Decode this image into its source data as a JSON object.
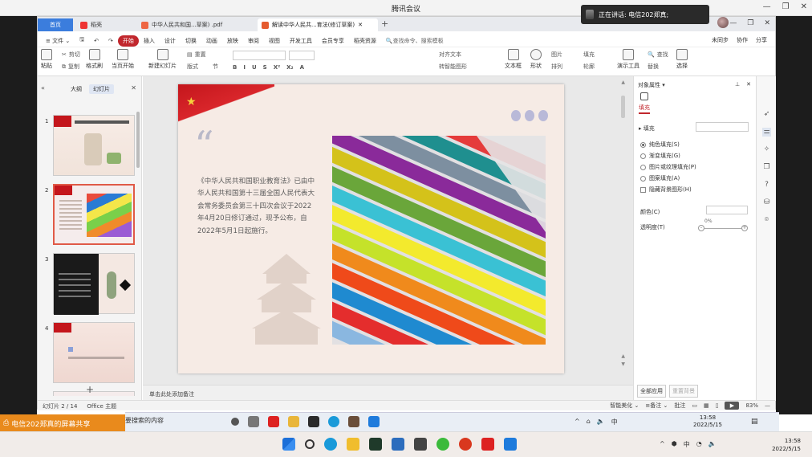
{
  "meeting": {
    "title": "腾讯会议",
    "speaking": "正在讲话: 电信202郑真;",
    "share_label": "电信202郑真的屏幕共享"
  },
  "tabs": {
    "home": "首页",
    "t2": "稻壳",
    "t3": "中华人民共和国...草案) .pdf",
    "t4": "解读中华人民共...育法(修订草案)",
    "plus": "+"
  },
  "menu": {
    "file": "≡ 文件 ⌄",
    "items": [
      "开始",
      "插入",
      "设计",
      "切换",
      "动画",
      "放映",
      "审阅",
      "视图",
      "开发工具",
      "会员专享",
      "稻壳资源"
    ],
    "search": "🔍查找命令、搜索模板",
    "right": [
      "未同步",
      "协作",
      "分享"
    ]
  },
  "ribbon": {
    "cut": "剪切",
    "copy": "复制",
    "painter": "格式刷",
    "paste": "粘贴",
    "from_start": "当页开始",
    "new_slide": "新建幻灯片",
    "layout": "版式",
    "section": "节",
    "reset": "重置",
    "textbox": "文本框",
    "shape": "形状",
    "arrange": "排列",
    "image": "图片",
    "fill": "填充",
    "outline": "轮廓",
    "slideshow": "演示工具",
    "find": "查找",
    "replace": "替换",
    "select": "选择",
    "align_text": "对齐文本",
    "smart": "转智能图形"
  },
  "leftpane": {
    "outline": "大纲",
    "slides": "幻灯片",
    "nums": [
      "1",
      "2",
      "3",
      "4"
    ],
    "add": "+"
  },
  "slide": {
    "quote": "“",
    "body": "《中华人民共和国职业教育法》已由中华人民共和国第十三届全国人民代表大会常务委员会第三十四次会议于2022年4月20日修订通过，现予公布，自2022年5月1日起施行。",
    "star": "★"
  },
  "notes": {
    "placeholder": "单击此处添加备注"
  },
  "props": {
    "title": "对象属性 ▾",
    "filltab": "填充",
    "fillrow": "▸ 填充",
    "opts": [
      "纯色填充(S)",
      "渐变填充(G)",
      "图片或纹理填充(P)",
      "图案填充(A)"
    ],
    "hide_bg": "隐藏背景图形(H)",
    "color": "颜色(C)",
    "trans": "透明度(T)",
    "pct": "0%",
    "apply_all": "全部应用",
    "reset_bg": "重置背景"
  },
  "status": {
    "slide": "幻灯片 2 / 14",
    "theme": "Office 主题",
    "beautify": "智能美化 ⌄",
    "notes": "≡备注 ⌄",
    "comment": "批注",
    "zoom": "83%"
  },
  "taskbar": {
    "search": "要搜索的内容",
    "time": "13:58",
    "date": "2022/5/15",
    "lang": "中"
  },
  "win": {
    "time": "13:58",
    "date": "2022/5/15",
    "lang": "中"
  }
}
